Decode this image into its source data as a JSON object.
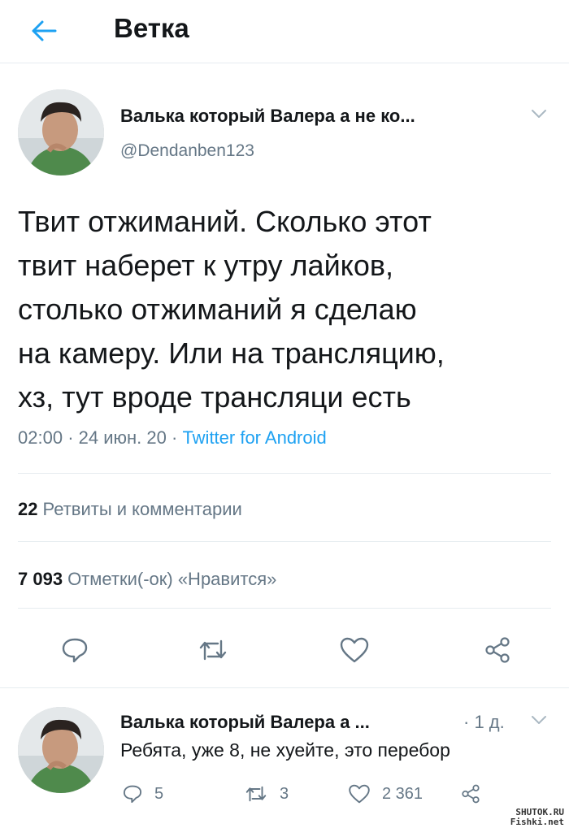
{
  "header": {
    "title": "Ветка"
  },
  "tweet": {
    "author_name": "Валька который Валера а не ко...",
    "author_handle": "@Dendanben123",
    "lines": [
      "Твит отжиманий. Сколько этот",
      "твит наберет к утру лайков,",
      "столько отжиманий я сделаю",
      "на камеру. Или на трансляцию,",
      "хз, тут вроде трансляци есть"
    ],
    "time": "02:00",
    "date": "24 июн. 20",
    "source": "Twitter for Android",
    "retweets_count": "22",
    "retweets_label": "Ретвиты и комментарии",
    "likes_count": "7 093",
    "likes_label": "Отметки(-ок) «Нравится»"
  },
  "reply": {
    "author_name": "Валька который Валера а ...",
    "time": "· 1 д.",
    "text": "Ребята, уже 8, не хуейте, это перебор",
    "reply_count": "5",
    "retweet_count": "3",
    "like_count": "2 361"
  },
  "watermark": {
    "line1": "SHUTOK.RU",
    "line2": "Fishki.net"
  },
  "icons": {
    "back": "arrow-left-icon",
    "caret": "chevron-down-icon",
    "reply": "comment-icon",
    "retweet": "retweet-icon",
    "like": "heart-icon",
    "share": "share-icon"
  },
  "colors": {
    "accent": "#1da1f2",
    "secondary_text": "#657786",
    "divider": "#e6ecf0"
  }
}
